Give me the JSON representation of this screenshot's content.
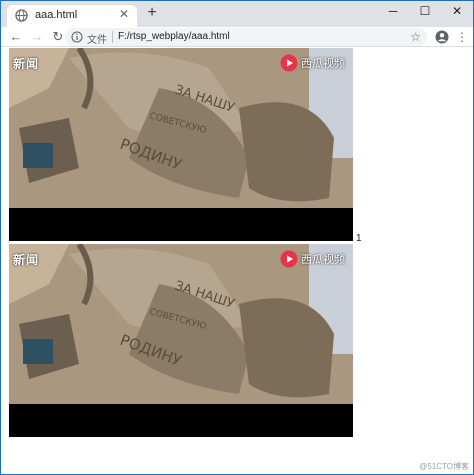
{
  "tab": {
    "title": "aaa.html",
    "close_glyph": "✕",
    "favicon": "globe-icon"
  },
  "newtab_glyph": "+",
  "window_controls": {
    "minimize": "─",
    "maximize": "☐",
    "close": "✕"
  },
  "toolbar": {
    "back": "←",
    "forward": "→",
    "reload": "↻",
    "scheme_label": "文件",
    "url": "F:/rtsp_webplay/aaa.html",
    "bookmark_glyph": "☆",
    "menu_glyph": "⋮"
  },
  "videos": [
    {
      "watermark_left": "新闻",
      "watermark_right": "西瓜视频"
    },
    {
      "watermark_left": "新闻",
      "watermark_right": "西瓜视频"
    }
  ],
  "between_label": "1",
  "corner_watermark": "@51CTO博客",
  "colors": {
    "frame": "#1f6fbf",
    "tabstrip": "#dee1e6",
    "stone": "#9b8a74",
    "logo_red": "#e8344a"
  }
}
